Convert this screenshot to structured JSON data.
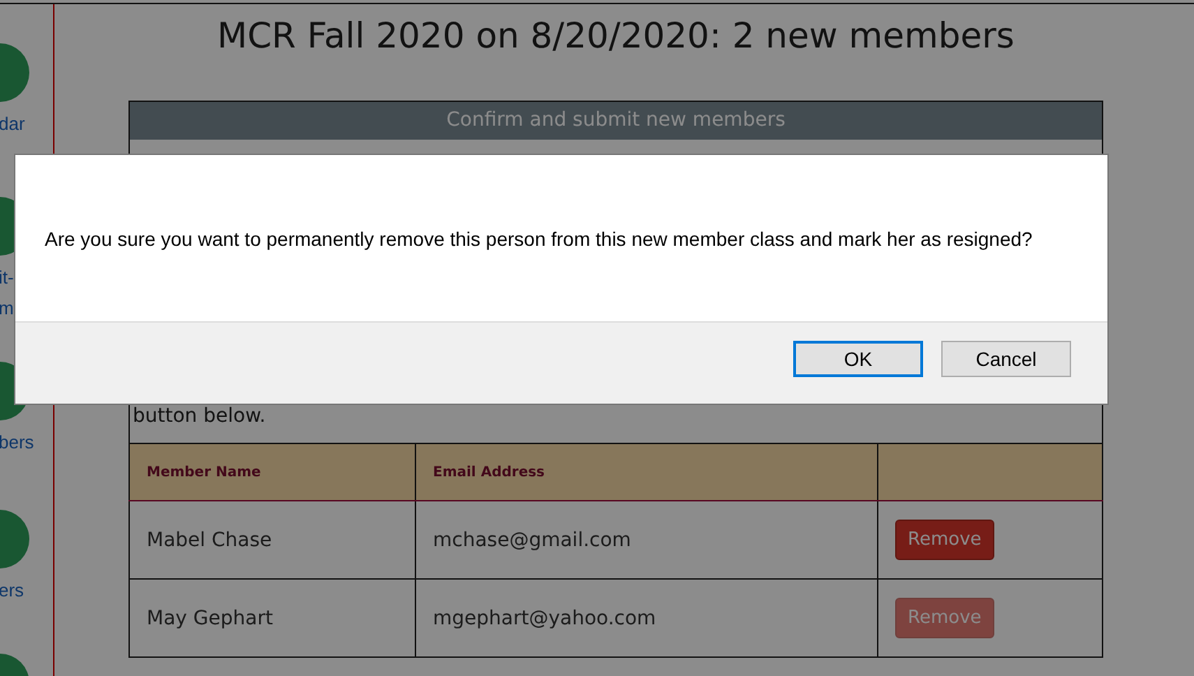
{
  "sidebar": {
    "items": [
      {
        "kind": "link",
        "label": "dar"
      },
      {
        "kind": "link",
        "label": "it-\nm"
      },
      {
        "kind": "link",
        "label": "bers"
      },
      {
        "kind": "link",
        "label": "ers"
      },
      {
        "kind": "icon"
      }
    ]
  },
  "page_title": "MCR Fall 2020 on 8/20/2020:  2 new members",
  "panel": {
    "header": "Confirm and submit new members",
    "text_tail": "button below.",
    "table": {
      "columns": [
        "Member Name",
        "Email Address"
      ],
      "rows": [
        {
          "name": "Mabel Chase",
          "email": "mchase@gmail.com",
          "action": "Remove",
          "disabled": false
        },
        {
          "name": "May Gephart",
          "email": "mgephart@yahoo.com",
          "action": "Remove",
          "disabled": true
        }
      ]
    }
  },
  "dialog": {
    "message": "Are you sure you want to permanently remove this person from this new member class and mark her as resigned?",
    "buttons": [
      {
        "label": "OK",
        "selected": true
      },
      {
        "label": "Cancel",
        "selected": false
      }
    ]
  }
}
